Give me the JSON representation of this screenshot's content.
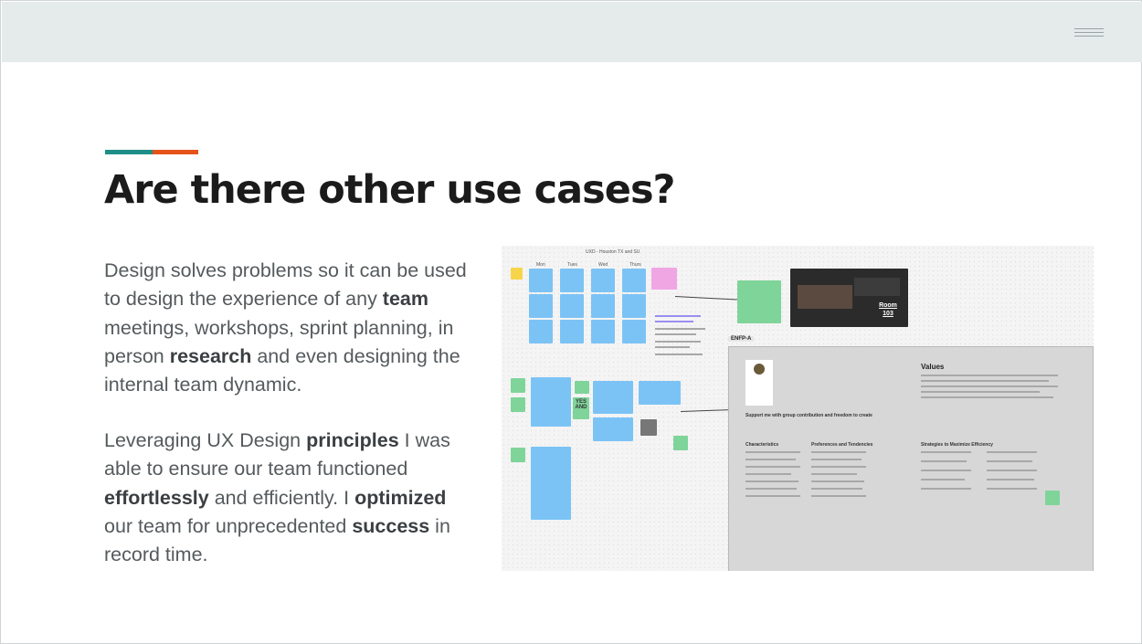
{
  "header": {
    "menu_icon": "hamburger-menu-icon"
  },
  "slide": {
    "title": "Are there other use cases?",
    "accent_colors": [
      "#1e8e86",
      "#e5531a"
    ],
    "paragraph1": [
      {
        "text": "Design solves problems so it can be used to design the experience of any ",
        "bold": false
      },
      {
        "text": "team",
        "bold": true
      },
      {
        "text": " meetings, workshops, sprint planning, in person ",
        "bold": false
      },
      {
        "text": "research",
        "bold": true
      },
      {
        "text": " and even designing the internal team dynamic.",
        "bold": false
      }
    ],
    "paragraph2": [
      {
        "text": "Leveraging UX Design ",
        "bold": false
      },
      {
        "text": "principles",
        "bold": true
      },
      {
        "text": " I was able to ensure our team functioned ",
        "bold": false
      },
      {
        "text": "effortlessly",
        "bold": true
      },
      {
        "text": " and efficiently. I ",
        "bold": false
      },
      {
        "text": "optimized",
        "bold": true
      },
      {
        "text": " our team for unprecedented ",
        "bold": false
      },
      {
        "text": "success",
        "bold": true
      },
      {
        "text": " in record time.",
        "bold": false
      }
    ]
  },
  "whiteboard": {
    "board_title": "UXD - Houston TX and SU",
    "column_labels": [
      "Mon",
      "Tues",
      "Wed",
      "Thurs"
    ],
    "sticky_yes_and": "YES AND",
    "room_label": "Room 103",
    "persona_tag": "ENFP-A",
    "values_heading": "Values",
    "persona_subtitle": "Support me with group contribution and freedom to create",
    "section_characteristics": "Characteristics",
    "section_preferences": "Preferences and Tendencies",
    "section_strategies": "Strategies to Maximize Efficiency"
  }
}
